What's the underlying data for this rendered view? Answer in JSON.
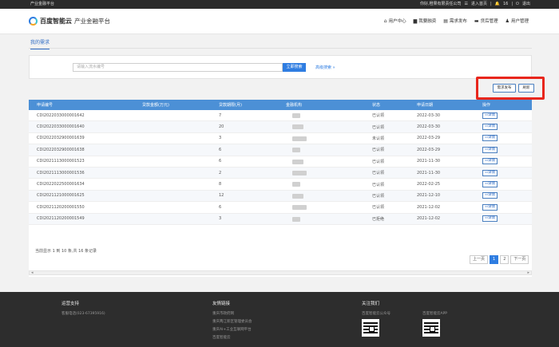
{
  "topbar": {
    "left": "产业金融平台",
    "greeting": "你好,橙果有限责任公司",
    "home": "进入首页",
    "count": "16",
    "logout": "退出"
  },
  "header": {
    "brand": "百度智能云",
    "platform": "产业金融平台"
  },
  "nav": [
    "用户中心",
    "我要融资",
    "需求发布",
    "贷后管理",
    "用户管理"
  ],
  "breadcrumb": "我的需求",
  "search": {
    "placeholder": "请输入流水编号",
    "button": "立即搜索",
    "advanced": "高级搜索"
  },
  "actions": {
    "publish": "需求发布",
    "refresh": "刷新"
  },
  "table": {
    "headers": [
      "申请编号",
      "贷款金额(万元)",
      "贷款期限(月)",
      "金融机构",
      "状态",
      "申请日期",
      "操作"
    ],
    "rows": [
      {
        "id": "CDI2022033000001642",
        "amount": "",
        "term": "7",
        "status": "已认领",
        "date": "2022-03-30"
      },
      {
        "id": "CDI2022033000001640",
        "amount": "",
        "term": "20",
        "status": "已认领",
        "date": "2022-03-30"
      },
      {
        "id": "CDI2022032900001639",
        "amount": "",
        "term": "3",
        "status": "未认领",
        "date": "2022-03-29"
      },
      {
        "id": "CDI2022032900001638",
        "amount": "",
        "term": "6",
        "status": "已认领",
        "date": "2022-03-29"
      },
      {
        "id": "CDI2021113000001523",
        "amount": "",
        "term": "6",
        "status": "已认领",
        "date": "2021-11-30"
      },
      {
        "id": "CDI2021113000001536",
        "amount": "",
        "term": "2",
        "status": "已认领",
        "date": "2021-11-30"
      },
      {
        "id": "CDI2022022500001634",
        "amount": "",
        "term": "8",
        "status": "已认领",
        "date": "2022-02-25"
      },
      {
        "id": "CDI2021121000001625",
        "amount": "",
        "term": "12",
        "status": "已认领",
        "date": "2021-12-10"
      },
      {
        "id": "CDI2021120200001550",
        "amount": "",
        "term": "6",
        "status": "已认领",
        "date": "2021-12-02"
      },
      {
        "id": "CDI2021120200001549",
        "amount": "",
        "term": "3",
        "status": "已拒绝",
        "date": "2021-12-02"
      }
    ],
    "detail_label": "详情"
  },
  "footnote": "当前显示 1 到 10 条,共 16 条记录",
  "pager": {
    "prev": "上一页",
    "pages": [
      "1",
      "2"
    ],
    "next": "下一页"
  },
  "footer": {
    "col1": {
      "title": "运营支持",
      "items": [
        "客服电话(023-67395916)"
      ]
    },
    "col2": {
      "title": "友情链接",
      "items": [
        "重庆市政府网",
        "重庆两江新区管理委员会",
        "重庆AI+工业互联网平台",
        "百度智能云"
      ]
    },
    "col3": {
      "title": "关注我们",
      "qr1": "百度智能云公众号",
      "qr2": "百度智能云APP"
    }
  }
}
